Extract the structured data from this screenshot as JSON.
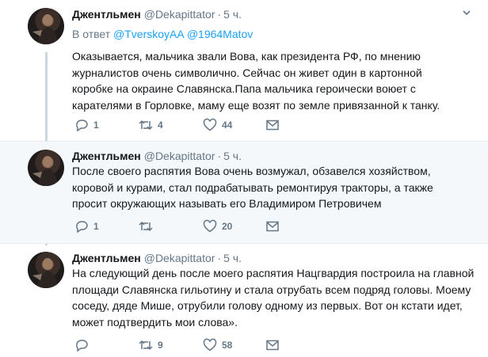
{
  "tweets": [
    {
      "name": "Джентльмен",
      "handle": "@Dekapittator",
      "dot": "·",
      "time": "5 ч.",
      "reply_prefix": "В ответ",
      "mentions": [
        "@TverskoyAA",
        "@1964Matov"
      ],
      "lines": [
        "Оказывается, мальчика звали Вова, как президента РФ, по мнению",
        "журналистов очень символично. Сейчас он живет один в картонной",
        "коробке на окраине Славянска.Папа мальчика героически воюет с",
        "карателями в Горловке, маму еще возят по земле привязанной к танку."
      ],
      "replies": "1",
      "retweets": "4",
      "likes": "44"
    },
    {
      "name": "Джентльмен",
      "handle": "@Dekapittator",
      "dot": "·",
      "time": "5 ч.",
      "lines": [
        "После своего распятия Вова очень возмужал, обзавелся хозяйством,",
        "коровой и курами, стал подрабатывать ремонтируя тракторы, а также",
        "просит окружающих называть его Владимиром Петровичем"
      ],
      "replies": "1",
      "retweets": "",
      "likes": "20"
    },
    {
      "name": "Джентльмен",
      "handle": "@Dekapittator",
      "dot": "·",
      "time": "5 ч.",
      "lines": [
        "На следующий день после моего распятия Нацгвардия построила на главной",
        "площади Славянска гильотину и стала отрубать всем подряд головы. Моему",
        "соседу, дяде Мише, отрубили голову одному из первых. Вот он кстати идет,",
        "может подтвердить мои слова»."
      ],
      "replies": "",
      "retweets": "9",
      "likes": "58"
    }
  ],
  "colors": {
    "accent": "#1da1f2",
    "muted": "#657786",
    "highlight_bg": "#f5f8fa",
    "thread_line": "#ccd6dd"
  },
  "icons": [
    "reply-icon",
    "retweet-icon",
    "like-icon",
    "dm-icon",
    "caret-down-icon"
  ]
}
